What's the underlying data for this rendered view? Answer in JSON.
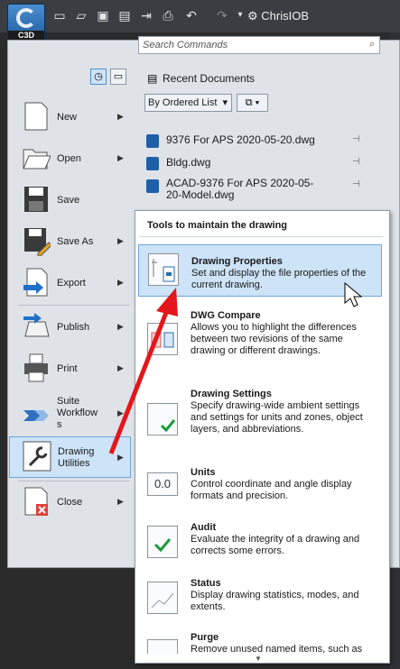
{
  "app": {
    "badge": "C3D",
    "user": "ChrisIOB"
  },
  "search": {
    "placeholder": "Search Commands"
  },
  "menu": [
    {
      "label": "New",
      "icon": "new-document-icon"
    },
    {
      "label": "Open",
      "icon": "folder-open-icon"
    },
    {
      "label": "Save",
      "icon": "floppy-disk-icon"
    },
    {
      "label": "Save As",
      "icon": "floppy-disk-pencil-icon"
    },
    {
      "label": "Export",
      "icon": "export-icon"
    },
    {
      "label": "Publish",
      "icon": "publish-icon"
    },
    {
      "label": "Print",
      "icon": "printer-icon"
    },
    {
      "label": "Suite\nWorkflow\ns",
      "icon": "suite-workflows-icon"
    },
    {
      "label": "Drawing\nUtilities",
      "icon": "wrench-icon"
    },
    {
      "label": "Close",
      "icon": "close-document-icon"
    }
  ],
  "recent": {
    "header": "Recent Documents",
    "order": "By Ordered List",
    "docs": [
      {
        "name": "9376 For APS 2020-05-20.dwg"
      },
      {
        "name": "Bldg.dwg"
      },
      {
        "name": "ACAD-9376 For APS 2020-05-20-Model.dwg"
      }
    ]
  },
  "flyout": {
    "header": "Tools to maintain the drawing",
    "items": [
      {
        "title": "Drawing Properties",
        "desc": "Set and display the file properties of the current drawing."
      },
      {
        "title": "DWG Compare",
        "desc": "Allows you to highlight the differences between two revisions of the same drawing or different drawings."
      },
      {
        "title": "Drawing Settings",
        "desc": "Specify drawing-wide ambient settings and settings for units and zones, object layers, and abbreviations."
      },
      {
        "title": "Units",
        "desc": "Control coordinate and angle display formats and precision.",
        "icon_text": "0.0"
      },
      {
        "title": "Audit",
        "desc": "Evaluate the integrity of a drawing and corrects some errors."
      },
      {
        "title": "Status",
        "desc": "Display drawing statistics, modes, and extents."
      },
      {
        "title": "Purge",
        "desc": "Remove unused named items, such as"
      }
    ]
  },
  "colors": {
    "accent": "#1e5fa8",
    "highlight": "#cde3f7",
    "arrow": "#e3161b"
  }
}
